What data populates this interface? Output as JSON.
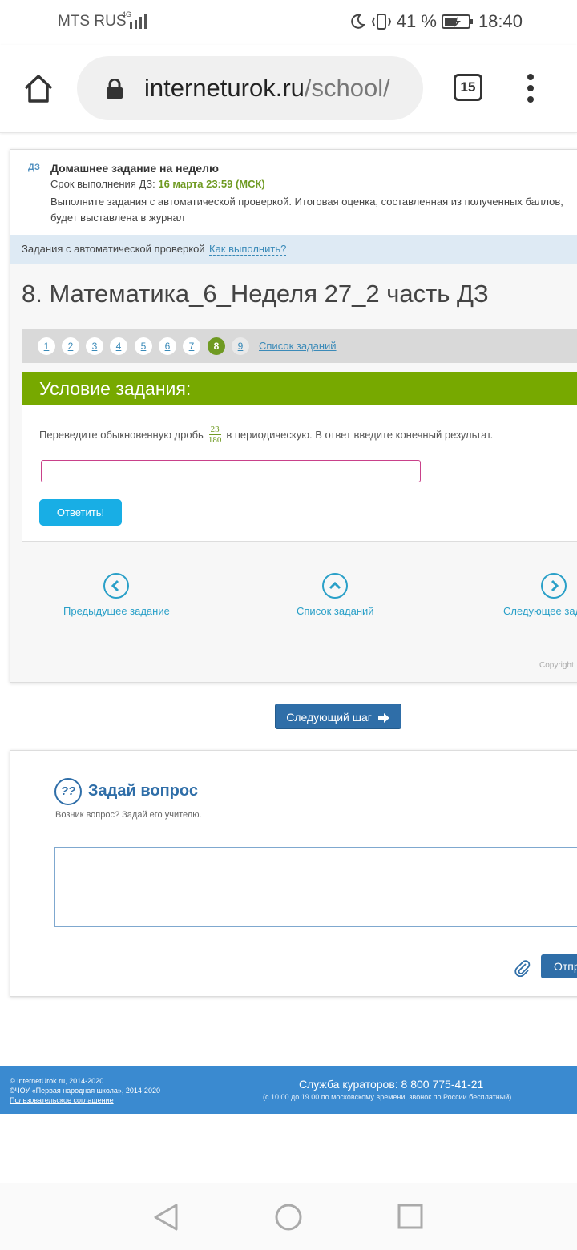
{
  "status_bar": {
    "carrier": "MTS RUS",
    "network": "4G",
    "battery": "41 %",
    "time": "18:40"
  },
  "browser": {
    "url_domain": "interneturok.ru",
    "url_path": "/school/",
    "tab_count": "15"
  },
  "homework": {
    "tag": "ДЗ",
    "title": "Домашнее задание на неделю",
    "deadline_label": "Срок выполнения ДЗ: ",
    "deadline_value": "16 марта 23:59 (МСК)",
    "description": "Выполните задания с автоматической проверкой. Итоговая оценка, составленная из полученных баллов, будет выставлена в журнал"
  },
  "auto_check": {
    "label": "Задания с автоматической проверкой",
    "how_link": "Как выполнить?"
  },
  "task_title": "8. Математика_6_Неделя 27_2 часть ДЗ",
  "pager": {
    "numbers": [
      "1",
      "2",
      "3",
      "4",
      "5",
      "6",
      "7",
      "8",
      "9"
    ],
    "active": "8",
    "list_link": "Список заданий"
  },
  "condition": {
    "header": "Условие задания:",
    "text_before": "Переведите обыкновенную дробь",
    "fraction_numerator": "23",
    "fraction_denominator": "180",
    "text_after": "в периодическую. В ответ введите конечный результат.",
    "answer_value": "",
    "answer_button": "Ответить!"
  },
  "navigation": {
    "prev": "Предыдущее задание",
    "list": "Список заданий",
    "next": "Следующее задание"
  },
  "copyright": "Copyright",
  "next_step_button": "Следующий шаг",
  "ask": {
    "title": "Задай вопрос",
    "subtitle": "Возник вопрос? Задай его учителю.",
    "question_value": "",
    "send_button": "Отправить"
  },
  "footer": {
    "line1": "© InternetUrok.ru, 2014-2020",
    "line2": "©ЧОУ «Первая народная школа», 2014-2020",
    "agreement_link": "Пользовательское соглашение",
    "service": "Служба кураторов: 8 800 775-41-21",
    "service_hours": "(с 10.00 до 19.00 по московскому времени, звонок по России бесплатный)"
  },
  "colors": {
    "green": "#77a900",
    "blue": "#2f6ea8",
    "cyan_button": "#18aee5",
    "footer_blue": "#3a8ad0"
  }
}
